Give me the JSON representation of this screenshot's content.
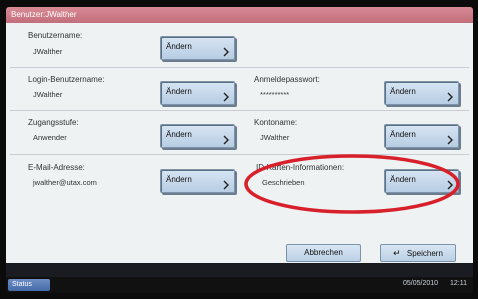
{
  "window": {
    "title": "Benutzer:JWalther"
  },
  "fields": {
    "username": {
      "label": "Benutzername:",
      "value": "JWalther",
      "button": "Ändern"
    },
    "login_username": {
      "label": "Login-Benutzername:",
      "value": "JWalther",
      "button": "Ändern"
    },
    "login_password": {
      "label": "Anmeldepasswort:",
      "value": "**********",
      "button": "Ändern"
    },
    "access_level": {
      "label": "Zugangsstufe:",
      "value": "Anwender",
      "button": "Ändern"
    },
    "account_name": {
      "label": "Kontoname:",
      "value": "JWalther",
      "button": "Ändern"
    },
    "email": {
      "label": "E-Mail-Adresse:",
      "value": "jwalther@utax.com",
      "button": "Ändern"
    },
    "info": {
      "label": "ID-Karten-Informationen:",
      "value": "Geschrieben",
      "button": "Ändern"
    }
  },
  "footer": {
    "cancel_label": "Abbrechen",
    "save_label": "Speichern"
  },
  "statusbar": {
    "status_label": "Status",
    "date": "05/05/2010",
    "time": "12:11"
  },
  "colors": {
    "highlight_ellipse": "#d8202a",
    "title_bar": "#c9747f"
  }
}
